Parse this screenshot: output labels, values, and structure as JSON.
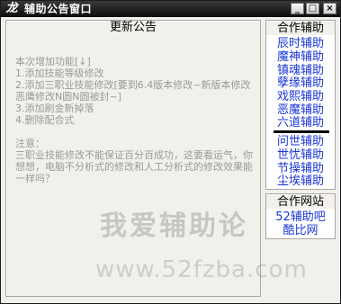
{
  "window": {
    "app_icon_glyph": "龙",
    "title": "辅助公告窗口",
    "controls": {
      "minimize": "_",
      "maximize": "□",
      "close": "×"
    }
  },
  "notice": {
    "title": "更新公告",
    "content": "本次增加功能[↓]\n1.添加技能等级修改\n2.添加三职业技能修改[要到6.4版本修改~新版本修改恶鹰修改N圆N圆被封~]\n3.添加刷金新掉落\n4.删除配合式\n\n注意：\n三职业技能修改不能保证百分百成功，这要看运气，你想想，电脑不分析式的修改和人工分析式的修改效果能一样吗？"
  },
  "cooperation": {
    "title": "合作辅助",
    "group1": [
      "辰时辅助",
      "魔神辅助",
      "镇魂辅助",
      "孽缘辅助",
      "戏熙辅助",
      "恶魔辅助",
      "六道辅助"
    ],
    "group2": [
      "问世辅助",
      "世忧辅助",
      "节操辅助",
      "尘埃辅助"
    ]
  },
  "websites": {
    "title": "合作网站",
    "items": [
      "52辅助吧",
      "酷比网"
    ]
  },
  "watermark": {
    "text": "我爱辅助论",
    "url": "www.52fzba.com"
  }
}
